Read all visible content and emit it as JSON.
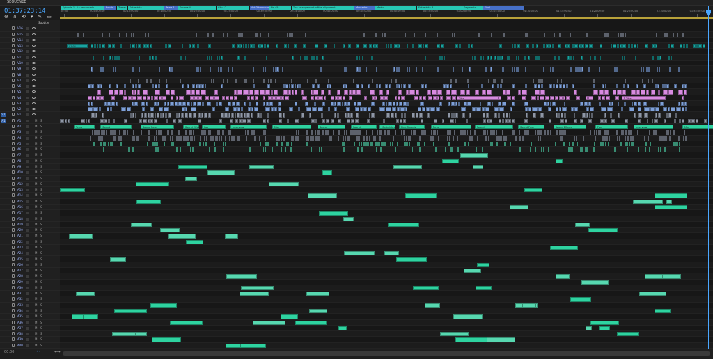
{
  "panel": {
    "tab_label": "SEQUENCE",
    "close_glyph": "≡"
  },
  "timecode": "01:37:23:14",
  "toolbar": {
    "icons": [
      "ripple-icon",
      "snap-icon",
      "linked-icon",
      "marker-icon",
      "wrench-icon",
      "caption-icon"
    ],
    "glyphs": [
      "⊕",
      "∩",
      "⟲",
      "▾",
      "✎",
      "▭"
    ]
  },
  "ruler": {
    "ticks": [
      "00:00",
      "00:05:00:00",
      "00:10:00:00",
      "00:15:00:00",
      "00:20:00:00",
      "00:25:00:00",
      "00:30:00:00",
      "00:35:00:00",
      "00:40:00:00",
      "00:45:00:00",
      "00:50:00:00",
      "00:55:00:00",
      "01:00:00:00",
      "01:05:00:00",
      "01:10:00:00",
      "01:15:00:00",
      "01:20:00:00",
      "01:25:00:00",
      "01:30:00:00",
      "01:35:00:00"
    ]
  },
  "markers": [
    {
      "label": "Episode 1 - La temporada",
      "color": "teal"
    },
    {
      "label": "Ronda",
      "color": "blue"
    },
    {
      "label": "Tomas 2",
      "color": "teal"
    },
    {
      "label": "Entrevista",
      "color": "teal"
    },
    {
      "label": "Tema 1",
      "color": "blue"
    },
    {
      "label": "Escena 4",
      "color": "teal"
    },
    {
      "label": "Clip 12",
      "color": "teal"
    },
    {
      "label": "Act 3 transicion",
      "color": "blue"
    },
    {
      "label": "Fin 45",
      "color": "teal"
    },
    {
      "label": "The arrangement of the alignment",
      "color": "teal"
    },
    {
      "label": "Marcador",
      "color": "blue"
    },
    {
      "label": "Medio",
      "color": "teal"
    },
    {
      "label": "Entrevista B",
      "color": "teal"
    },
    {
      "label": "Segmento",
      "color": "teal"
    },
    {
      "label": "Final",
      "color": "blue"
    }
  ],
  "headers": {
    "subtitle_label": "Subtitle",
    "video_tracks": [
      "V16",
      "V15",
      "V14",
      "V13",
      "V12",
      "V11",
      "V10",
      "V9",
      "V8",
      "V7",
      "V6",
      "V5",
      "V4",
      "V3",
      "V2",
      "V1"
    ],
    "audio_tracks": [
      "A1",
      "A2",
      "A3",
      "A4",
      "A5",
      "A6",
      "A7",
      "A8",
      "A9",
      "A10",
      "A11",
      "A12",
      "A13",
      "A14",
      "A15",
      "A16",
      "A17",
      "A18",
      "A19",
      "A20",
      "A21",
      "A22",
      "A23",
      "A24",
      "A25",
      "A26",
      "A27",
      "A28",
      "A29",
      "A30",
      "A31",
      "A32",
      "A33",
      "A34",
      "A35",
      "A36",
      "A37",
      "A38",
      "A39",
      "A40"
    ],
    "target_v": "V1",
    "target_a": "A1",
    "mute_label": "M",
    "solo_label": "S"
  },
  "clip_labels": {
    "a1": [
      "Tema",
      "Sound",
      "Sound Fuse",
      "Sound Effects",
      "Fox",
      "Interview",
      "Mix",
      "Sound",
      "Sound",
      "Music Library",
      "Pink Sounds"
    ],
    "v14": [
      "01:01"
    ],
    "v8": [
      "Title",
      "Title",
      "Title"
    ]
  },
  "colors": {
    "accent_blue": "#4aa7ff",
    "video_teal": "#1aa3a0",
    "video_blue": "#7ea0d8",
    "video_pink": "#d78be0",
    "audio_green": "#2ed3a0",
    "marker_teal": "#27c7b4",
    "marker_blue": "#4670c8",
    "work_area": "#b9a23a"
  },
  "bottom": {
    "left_label": "00:00",
    "zoom_label": "◦◦"
  }
}
